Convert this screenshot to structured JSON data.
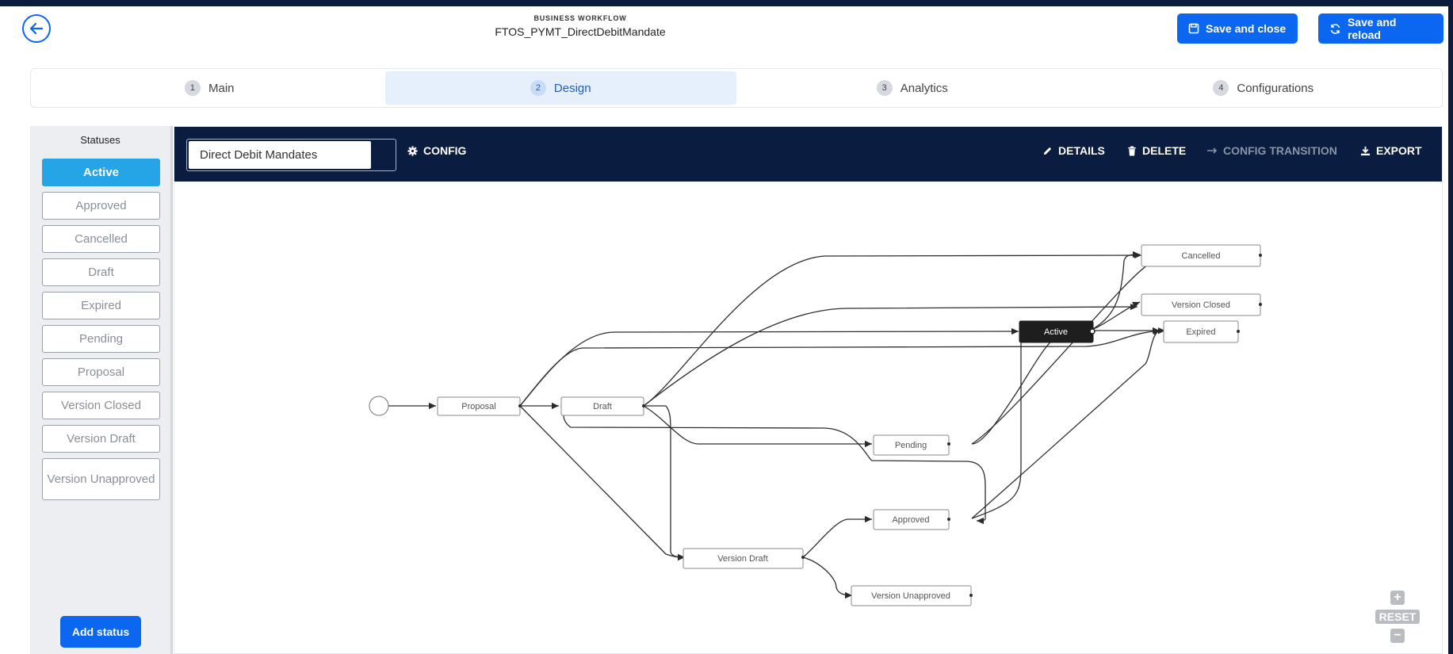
{
  "header": {
    "kicker": "BUSINESS WORKFLOW",
    "title": "FTOS_PYMT_DirectDebitMandate",
    "save_close": "Save and close",
    "save_reload": "Save and reload"
  },
  "tabs": [
    {
      "num": "1",
      "label": "Main"
    },
    {
      "num": "2",
      "label": "Design"
    },
    {
      "num": "3",
      "label": "Analytics"
    },
    {
      "num": "4",
      "label": "Configurations"
    }
  ],
  "sidebar": {
    "title": "Statuses",
    "items": [
      "Active",
      "Approved",
      "Cancelled",
      "Draft",
      "Expired",
      "Pending",
      "Proposal",
      "Version Closed",
      "Version Draft",
      "Version Unapproved"
    ],
    "add_button": "Add status"
  },
  "toolbar": {
    "workflow_name": "Direct Debit Mandates",
    "config": "CONFIG",
    "details": "DETAILS",
    "delete": "DELETE",
    "config_transition": "CONFIG TRANSITION",
    "export": "EXPORT"
  },
  "diagram": {
    "nodes": [
      "Proposal",
      "Draft",
      "Pending",
      "Approved",
      "Version Draft",
      "Version Unapproved",
      "Active",
      "Cancelled",
      "Version Closed",
      "Expired"
    ],
    "selected": "Active"
  },
  "zoom": {
    "plus": "+",
    "reset": "RESET",
    "minus": "−"
  }
}
